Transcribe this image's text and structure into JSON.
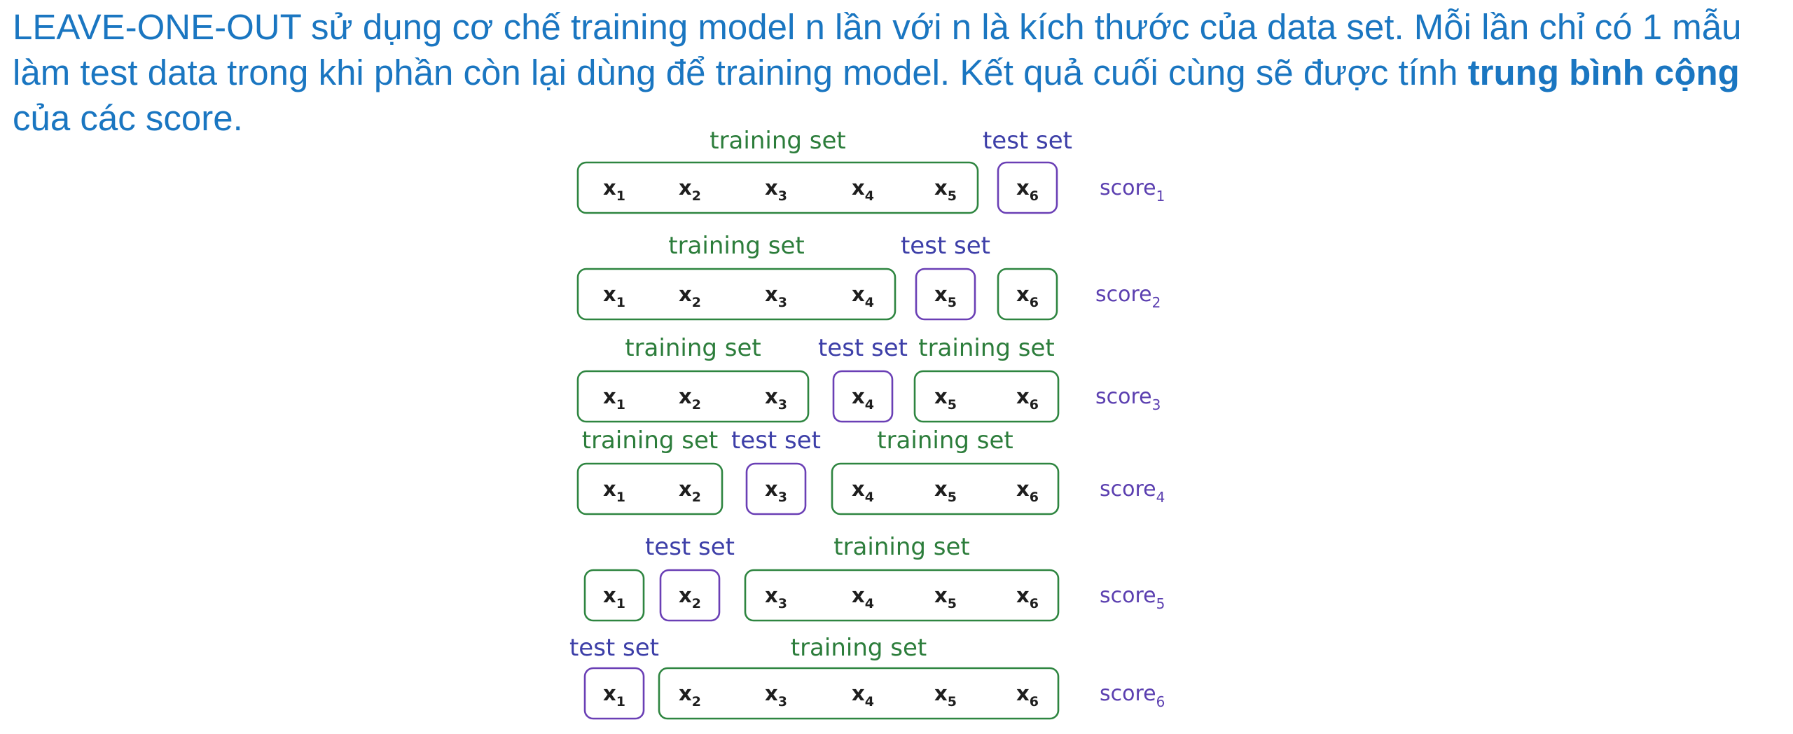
{
  "intro": {
    "text_before": "LEAVE-ONE-OUT sử dụng cơ chế training model n lần với n là kích thước của data set. Mỗi lần chỉ có 1 mẫu làm test data trong khi phần còn lại dùng để training model. Kết quả cuối cùng sẽ được tính ",
    "text_bold": "trung bình cộng",
    "text_after": " của các score."
  },
  "diagram": {
    "training_label": "training set",
    "test_label": "test set",
    "sample_letter": "x",
    "sample_indices": [
      "1",
      "2",
      "3",
      "4",
      "5",
      "6"
    ],
    "score_word": "score",
    "colors": {
      "intro_text": "#1a76c1",
      "training_border": "#2e8540",
      "training_label": "#2c7d3b",
      "test_border": "#6a3fb5",
      "test_label": "#3d3fa8",
      "score_text": "#5b3fb0"
    },
    "folds": [
      {
        "score_index": "1",
        "groups": [
          {
            "type": "training",
            "items": [
              1,
              2,
              3,
              4,
              5
            ]
          },
          {
            "type": "test",
            "items": [
              6
            ]
          }
        ]
      },
      {
        "score_index": "2",
        "groups": [
          {
            "type": "training",
            "items": [
              1,
              2,
              3,
              4
            ]
          },
          {
            "type": "test",
            "items": [
              5
            ]
          },
          {
            "type": "unlabeled",
            "items": [
              6
            ]
          }
        ]
      },
      {
        "score_index": "3",
        "groups": [
          {
            "type": "training",
            "items": [
              1,
              2,
              3
            ]
          },
          {
            "type": "test",
            "items": [
              4
            ]
          },
          {
            "type": "training",
            "items": [
              5,
              6
            ]
          }
        ]
      },
      {
        "score_index": "4",
        "groups": [
          {
            "type": "training",
            "items": [
              1,
              2
            ]
          },
          {
            "type": "test",
            "items": [
              3
            ]
          },
          {
            "type": "training",
            "items": [
              4,
              5,
              6
            ]
          }
        ]
      },
      {
        "score_index": "5",
        "groups": [
          {
            "type": "unlabeled",
            "items": [
              1
            ]
          },
          {
            "type": "test",
            "items": [
              2
            ]
          },
          {
            "type": "training",
            "items": [
              3,
              4,
              5,
              6
            ]
          }
        ]
      },
      {
        "score_index": "6",
        "groups": [
          {
            "type": "test",
            "items": [
              1
            ]
          },
          {
            "type": "training",
            "items": [
              2,
              3,
              4,
              5,
              6
            ]
          }
        ]
      }
    ]
  }
}
